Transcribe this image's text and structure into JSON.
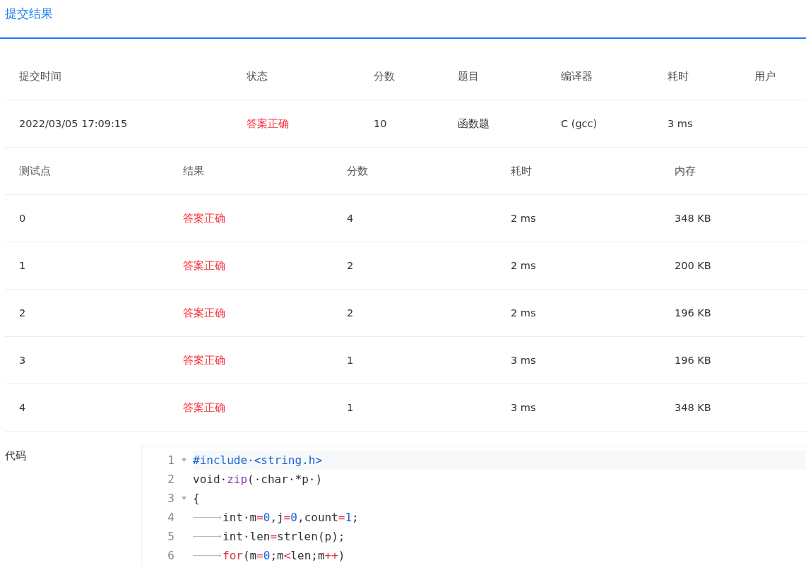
{
  "header": {
    "title": "提交结果"
  },
  "summary": {
    "columns": [
      "提交时间",
      "状态",
      "分数",
      "题目",
      "编译器",
      "耗时",
      "用户"
    ],
    "rows": [
      {
        "cells": [
          {
            "text": "2022/03/05 17:09:15"
          },
          {
            "text": "答案正确",
            "color": "#f5333f"
          },
          {
            "text": "10"
          },
          {
            "text": "函数题"
          },
          {
            "text": "C (gcc)"
          },
          {
            "text": "3 ms"
          }
        ]
      }
    ]
  },
  "tests": {
    "columns": [
      "测试点",
      "结果",
      "分数",
      "耗时",
      "内存"
    ],
    "rows": [
      {
        "cells": [
          {
            "text": "0"
          },
          {
            "text": "答案正确",
            "color": "#f5333f"
          },
          {
            "text": "4"
          },
          {
            "text": "2 ms"
          },
          {
            "text": "348 KB"
          }
        ]
      },
      {
        "cells": [
          {
            "text": "1"
          },
          {
            "text": "答案正确",
            "color": "#f5333f"
          },
          {
            "text": "2"
          },
          {
            "text": "2 ms"
          },
          {
            "text": "200 KB"
          }
        ]
      },
      {
        "cells": [
          {
            "text": "2"
          },
          {
            "text": "答案正确",
            "color": "#f5333f"
          },
          {
            "text": "2"
          },
          {
            "text": "2 ms"
          },
          {
            "text": "196 KB"
          }
        ]
      },
      {
        "cells": [
          {
            "text": "3"
          },
          {
            "text": "答案正确",
            "color": "#f5333f"
          },
          {
            "text": "1"
          },
          {
            "text": "3 ms"
          },
          {
            "text": "196 KB"
          }
        ]
      },
      {
        "cells": [
          {
            "text": "4"
          },
          {
            "text": "答案正确",
            "color": "#f5333f"
          },
          {
            "text": "1"
          },
          {
            "text": "3 ms"
          },
          {
            "text": "348 KB"
          }
        ]
      }
    ]
  },
  "code": {
    "label": "代码",
    "lines": [
      {
        "number": "1",
        "fold": true,
        "active": true,
        "indent": false,
        "tokens": [
          {
            "kind": "preproc",
            "text": "#include·<string.h>"
          }
        ]
      },
      {
        "number": "2",
        "fold": false,
        "active": false,
        "indent": false,
        "tokens": [
          {
            "kind": "plain",
            "text": "void·"
          },
          {
            "kind": "function",
            "text": "zip"
          },
          {
            "kind": "plain",
            "text": "(·char·*p·)"
          }
        ]
      },
      {
        "number": "3",
        "fold": true,
        "active": false,
        "indent": false,
        "tokens": [
          {
            "kind": "plain",
            "text": "{"
          }
        ]
      },
      {
        "number": "4",
        "fold": false,
        "active": false,
        "indent": true,
        "tokens": [
          {
            "kind": "plain",
            "text": "int·m"
          },
          {
            "kind": "operator",
            "text": "="
          },
          {
            "kind": "number",
            "text": "0"
          },
          {
            "kind": "plain",
            "text": ",j"
          },
          {
            "kind": "operator",
            "text": "="
          },
          {
            "kind": "number",
            "text": "0"
          },
          {
            "kind": "plain",
            "text": ",count"
          },
          {
            "kind": "operator",
            "text": "="
          },
          {
            "kind": "number",
            "text": "1"
          },
          {
            "kind": "plain",
            "text": ";"
          }
        ]
      },
      {
        "number": "5",
        "fold": false,
        "active": false,
        "indent": true,
        "tokens": [
          {
            "kind": "plain",
            "text": "int·len"
          },
          {
            "kind": "operator",
            "text": "="
          },
          {
            "kind": "plain",
            "text": "strlen(p);"
          }
        ]
      },
      {
        "number": "6",
        "fold": false,
        "active": false,
        "indent": true,
        "tokens": [
          {
            "kind": "keyword",
            "text": "for"
          },
          {
            "kind": "plain",
            "text": "(m"
          },
          {
            "kind": "operator",
            "text": "="
          },
          {
            "kind": "number",
            "text": "0"
          },
          {
            "kind": "plain",
            "text": ";m"
          },
          {
            "kind": "operator",
            "text": "<"
          },
          {
            "kind": "plain",
            "text": "len;m"
          },
          {
            "kind": "operator",
            "text": "++"
          },
          {
            "kind": "plain",
            "text": ")"
          }
        ]
      }
    ]
  }
}
